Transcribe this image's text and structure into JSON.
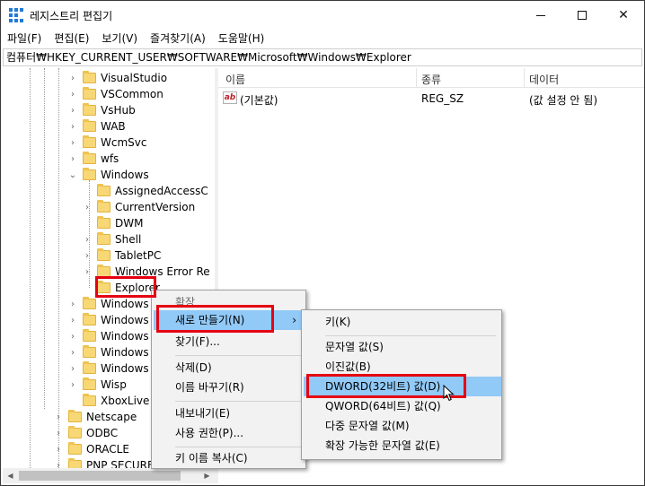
{
  "window": {
    "title": "레지스트리 편집기",
    "controls": {
      "minimize": "—",
      "maximize": "☐",
      "close": "✕"
    }
  },
  "menubar": [
    {
      "label": "파일(F)"
    },
    {
      "label": "편집(E)"
    },
    {
      "label": "보기(V)"
    },
    {
      "label": "즐겨찾기(A)"
    },
    {
      "label": "도움말(H)"
    }
  ],
  "address": "컴퓨터₩HKEY_CURRENT_USER₩SOFTWARE₩Microsoft₩Windows₩Explorer",
  "tree": {
    "items": [
      {
        "label": "VisualStudio",
        "chevron": "›"
      },
      {
        "label": "VSCommon",
        "chevron": "›"
      },
      {
        "label": "VsHub",
        "chevron": "›"
      },
      {
        "label": "WAB",
        "chevron": "›"
      },
      {
        "label": "WcmSvc",
        "chevron": "›"
      },
      {
        "label": "wfs",
        "chevron": "›"
      },
      {
        "label": "Windows",
        "chevron": "⌄"
      },
      {
        "label": "AssignedAccessC",
        "chevron": ""
      },
      {
        "label": "CurrentVersion",
        "chevron": "›"
      },
      {
        "label": "DWM",
        "chevron": ""
      },
      {
        "label": "Shell",
        "chevron": "›"
      },
      {
        "label": "TabletPC",
        "chevron": "›"
      },
      {
        "label": "Windows Error Re",
        "chevron": "›"
      },
      {
        "label": "Explorer",
        "chevron": ""
      },
      {
        "label": "Windows N",
        "chevron": "›"
      },
      {
        "label": "Windows S",
        "chevron": "›"
      },
      {
        "label": "Windows S",
        "chevron": "›"
      },
      {
        "label": "Windows S",
        "chevron": "›"
      },
      {
        "label": "Windows S",
        "chevron": "›"
      },
      {
        "label": "Wisp",
        "chevron": "›"
      },
      {
        "label": "XboxLive",
        "chevron": ""
      },
      {
        "label": "Netscape",
        "chevron": "›"
      },
      {
        "label": "ODBC",
        "chevron": "›"
      },
      {
        "label": "ORACLE",
        "chevron": "›"
      },
      {
        "label": "PNP SECURE",
        "chevron": "›"
      }
    ]
  },
  "list": {
    "headers": {
      "name": "이름",
      "type": "종류",
      "data": "데이터"
    },
    "rows": [
      {
        "icon": "ab",
        "name": "(기본값)",
        "type": "REG_SZ",
        "data": "(값 설정 안 됨)"
      }
    ]
  },
  "context_menu": {
    "header": "확장",
    "items": [
      {
        "label": "새로 만들기(N)",
        "arrow": "›"
      },
      {
        "label": "찾기(F)..."
      },
      {
        "label": "삭제(D)"
      },
      {
        "label": "이름 바꾸기(R)"
      },
      {
        "label": "내보내기(E)"
      },
      {
        "label": "사용 권한(P)..."
      },
      {
        "label": "키 이름 복사(C)"
      }
    ]
  },
  "submenu": {
    "items": [
      {
        "label": "키(K)"
      },
      {
        "label": "문자열 값(S)"
      },
      {
        "label": "이진값(B)"
      },
      {
        "label": "DWORD(32비트) 값(D)"
      },
      {
        "label": "QWORD(64비트) 값(Q)"
      },
      {
        "label": "다중 문자열 값(M)"
      },
      {
        "label": "확장 가능한 문자열 값(E)"
      }
    ]
  },
  "scroll": {
    "left": "◀",
    "right": "▶"
  },
  "colors": {
    "highlight": "#91c9f7",
    "annotation": "#e60012",
    "folder": "#f8d775"
  }
}
